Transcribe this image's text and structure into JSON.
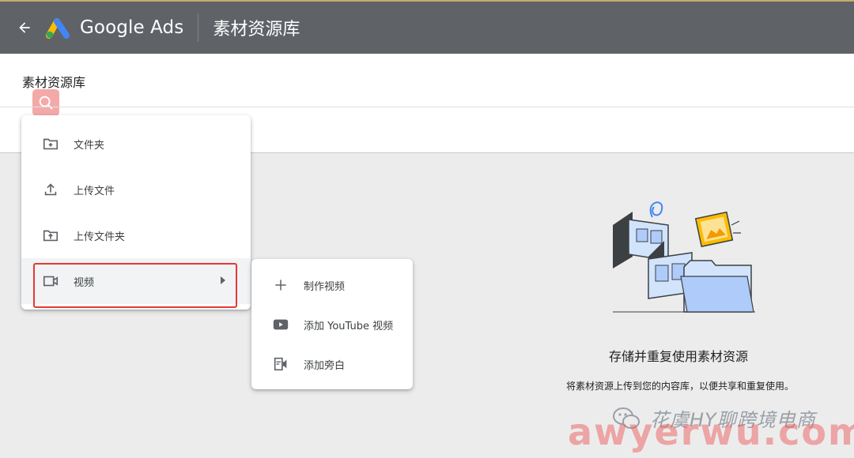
{
  "header": {
    "brand_name": "Google Ads",
    "app_title": "素材资源库",
    "accent_color": "#5f6368"
  },
  "page": {
    "title": "素材资源库"
  },
  "add_menu": {
    "items": [
      {
        "label": "文件夹",
        "icon": "folder-add-icon"
      },
      {
        "label": "上传文件",
        "icon": "upload-icon"
      },
      {
        "label": "上传文件夹",
        "icon": "upload-folder-icon"
      },
      {
        "label": "视频",
        "icon": "video-camera-icon",
        "has_submenu": true,
        "highlighted": true
      }
    ]
  },
  "video_submenu": {
    "items": [
      {
        "label": "制作视频",
        "icon": "plus-icon"
      },
      {
        "label": "添加 YouTube 视频",
        "icon": "youtube-icon"
      },
      {
        "label": "添加旁白",
        "icon": "voiceover-icon"
      }
    ]
  },
  "empty_state": {
    "title": "存储并重复使用素材资源",
    "description": "将素材资源上传到您的内容库，以便共享和重复使用。"
  },
  "watermarks": {
    "account": "花虞HY聊跨境电商",
    "site": "awyerwu.com"
  }
}
